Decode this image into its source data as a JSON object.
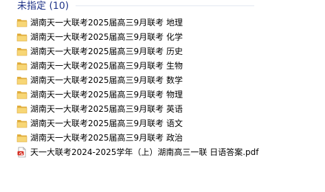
{
  "group": {
    "title": "未指定 (10)"
  },
  "items": [
    {
      "name": "湖南天一大联考2025届高三9月联考 地理",
      "icon": "folder-icon"
    },
    {
      "name": "湖南天一大联考2025届高三9月联考 化学",
      "icon": "folder-icon"
    },
    {
      "name": "湖南天一大联考2025届高三9月联考 历史",
      "icon": "folder-icon"
    },
    {
      "name": "湖南天一大联考2025届高三9月联考 生物",
      "icon": "folder-icon"
    },
    {
      "name": "湖南天一大联考2025届高三9月联考 数学",
      "icon": "folder-icon"
    },
    {
      "name": "湖南天一大联考2025届高三9月联考 物理",
      "icon": "folder-icon"
    },
    {
      "name": "湖南天一大联考2025届高三9月联考 英语",
      "icon": "folder-icon"
    },
    {
      "name": "湖南天一大联考2025届高三9月联考 语文",
      "icon": "folder-icon"
    },
    {
      "name": "湖南天一大联考2025届高三9月联考 政治",
      "icon": "folder-icon"
    },
    {
      "name": "天一大联考2024-2025学年（上）湖南高三一联 日语答案.pdf",
      "icon": "pdf-icon"
    }
  ],
  "colors": {
    "group_title": "#1e3287",
    "folder_body": "#e8b94a",
    "folder_front": "#f6d274",
    "pdf_accent": "#d42a1e"
  }
}
